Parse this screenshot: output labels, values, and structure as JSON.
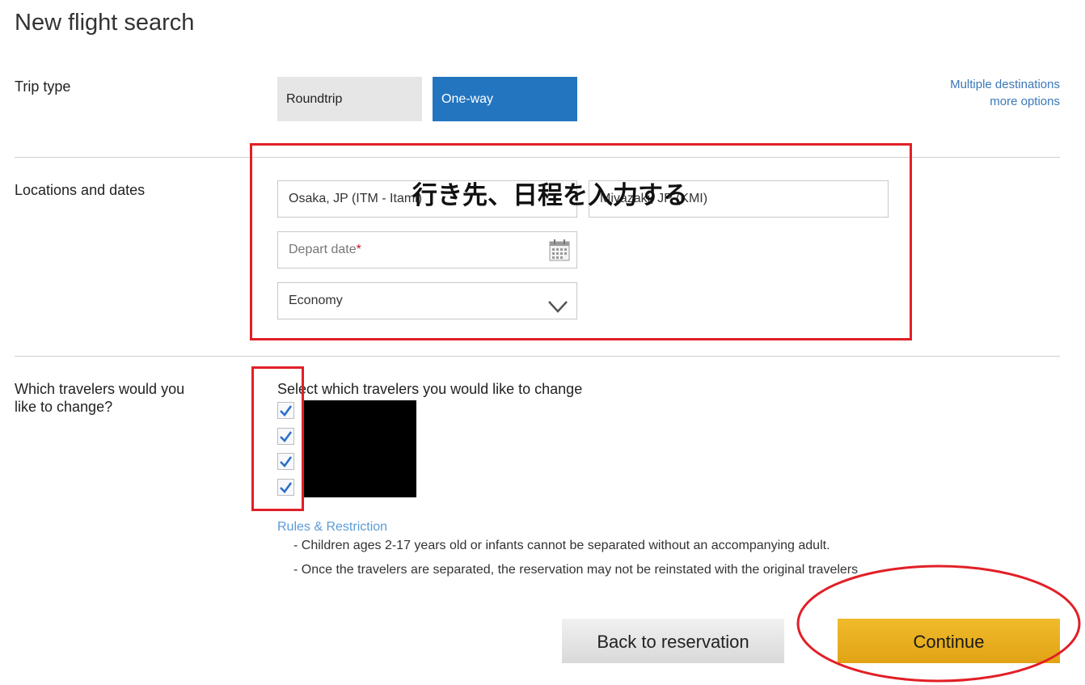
{
  "page": {
    "title": "New flight search"
  },
  "trip_type": {
    "label": "Trip type",
    "options": [
      "Roundtrip",
      "One-way"
    ],
    "selected": "One-way",
    "links": {
      "multiple_destinations": "Multiple destinations",
      "more_options": "more options"
    }
  },
  "locations": {
    "label": "Locations and dates",
    "origin_value": "Osaka, JP (ITM - Itami)",
    "destination_value": "Miyazaki, JP (KMI)",
    "depart_placeholder": "Depart date",
    "required_mark": "*",
    "cabin_value": "Economy"
  },
  "annotation": {
    "text": "行き先、日程を入力する"
  },
  "travelers": {
    "label": "Which travelers would you like to change?",
    "prompt": "Select which travelers you would like to change",
    "checkbox_count": 4,
    "checked": [
      true,
      true,
      true,
      true
    ],
    "rules_link": "Rules & Restriction",
    "rules": [
      "- Children ages 2-17 years old or infants cannot be separated without an accompanying adult.",
      "- Once the travelers are separated, the reservation may not be reinstated with the original travelers"
    ]
  },
  "actions": {
    "back_label": "Back to reservation",
    "continue_label": "Continue"
  },
  "colors": {
    "primary_blue": "#2375c0",
    "continue_gold": "#e8ad1f",
    "annotation_red": "#e21f26",
    "link_blue": "#3a78b8"
  }
}
